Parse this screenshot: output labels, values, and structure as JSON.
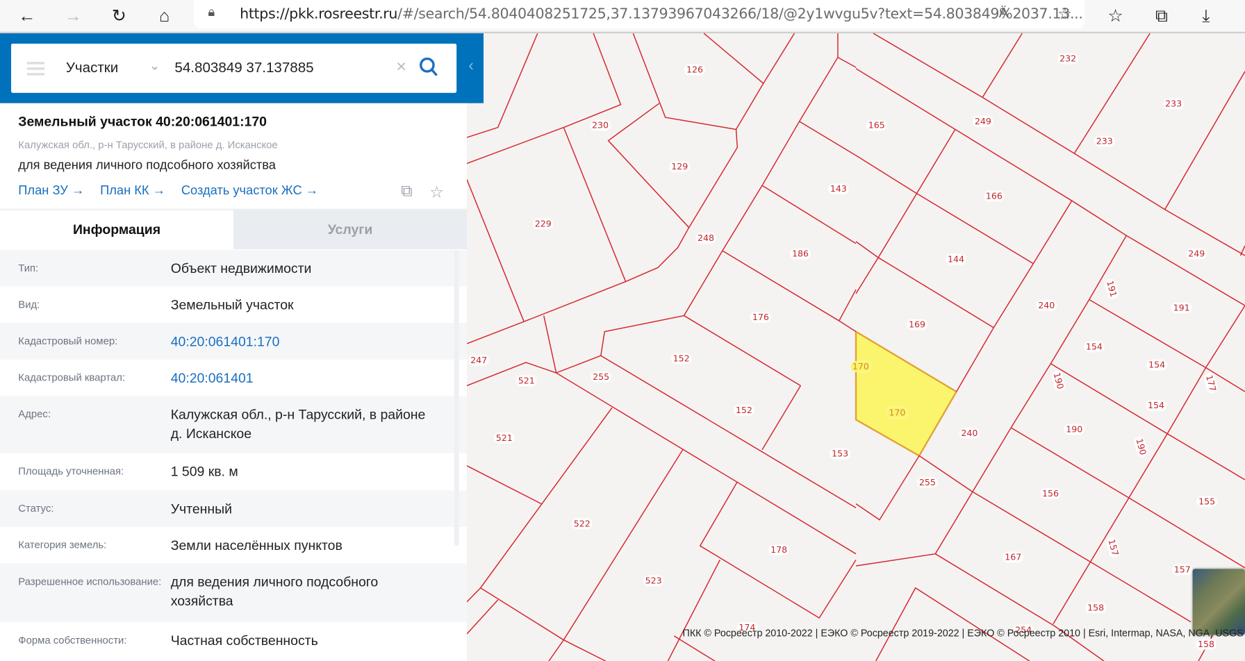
{
  "browser": {
    "url_host": "https://pkk.rosreestr.ru",
    "url_rest": "/#/search/54.8040408251725,37.13793967043266/18/@2y1wvgu5v?text=54.803849%2037.13...",
    "icons": [
      "back-icon",
      "forward-icon",
      "refresh-icon",
      "home-icon",
      "lock-icon",
      "read-aloud-icon",
      "add-favorite-icon",
      "favorites-icon",
      "collections-icon",
      "downloads-icon"
    ]
  },
  "search": {
    "category": "Участки",
    "query": "54.803849 37.137885"
  },
  "object": {
    "title": "Земельный участок 40:20:061401:170",
    "address_short": "Калужская обл., р-н Тарусский, в районе д. Исканское",
    "usage": "для ведения личного подсобного хозяйства",
    "links": [
      "План ЗУ →",
      "План КК →",
      "Создать участок ЖС →"
    ]
  },
  "tabs": [
    {
      "label": "Информация",
      "active": true
    },
    {
      "label": "Услуги",
      "active": false
    }
  ],
  "rows": [
    {
      "label": "Тип:",
      "value": "Объект недвижимости"
    },
    {
      "label": "Вид:",
      "value": "Земельный участок"
    },
    {
      "label": "Кадастровый номер:",
      "value": "40:20:061401:170"
    },
    {
      "label": "Кадастровый квартал:",
      "value": "40:20:061401"
    },
    {
      "label": "Адрес:",
      "value": "Калужская обл., р-н Тарусский, в районе д. Исканское"
    },
    {
      "label": "Площадь уточненная:",
      "value": "1 509 кв. м"
    },
    {
      "label": "Статус:",
      "value": "Учтенный"
    },
    {
      "label": "Категория земель:",
      "value": "Земли населённых пунктов"
    },
    {
      "label": "Разрешенное использование:",
      "value": "для ведения личного подсобного хозяйства"
    },
    {
      "label": "Форма собственности:",
      "value": "Частная собственность"
    }
  ],
  "map": {
    "parcel_color": "#d7262e",
    "highlight_color": "#fbf56e",
    "labels": [
      "126",
      "230",
      "129",
      "229",
      "248",
      "232",
      "165",
      "249",
      "233",
      "233",
      "143",
      "166",
      "186",
      "144",
      "249",
      "240",
      "191",
      "191",
      "176",
      "169",
      "152",
      "247",
      "521",
      "255",
      "170",
      "154",
      "154",
      "177",
      "152",
      "170",
      "190",
      "154",
      "521",
      "240",
      "190",
      "190",
      "153",
      "255",
      "156",
      "155",
      "522",
      "178",
      "167",
      "157",
      "157",
      "523",
      "158",
      "174",
      "254",
      "158"
    ],
    "attribution": "ПКК © Росреестр 2010-2022 | ЕЭКО © Росреестр 2019-2022 | ЕЭКО © Росреестр 2010 | Esri, Intermap, NASA, NGA, USGS"
  }
}
